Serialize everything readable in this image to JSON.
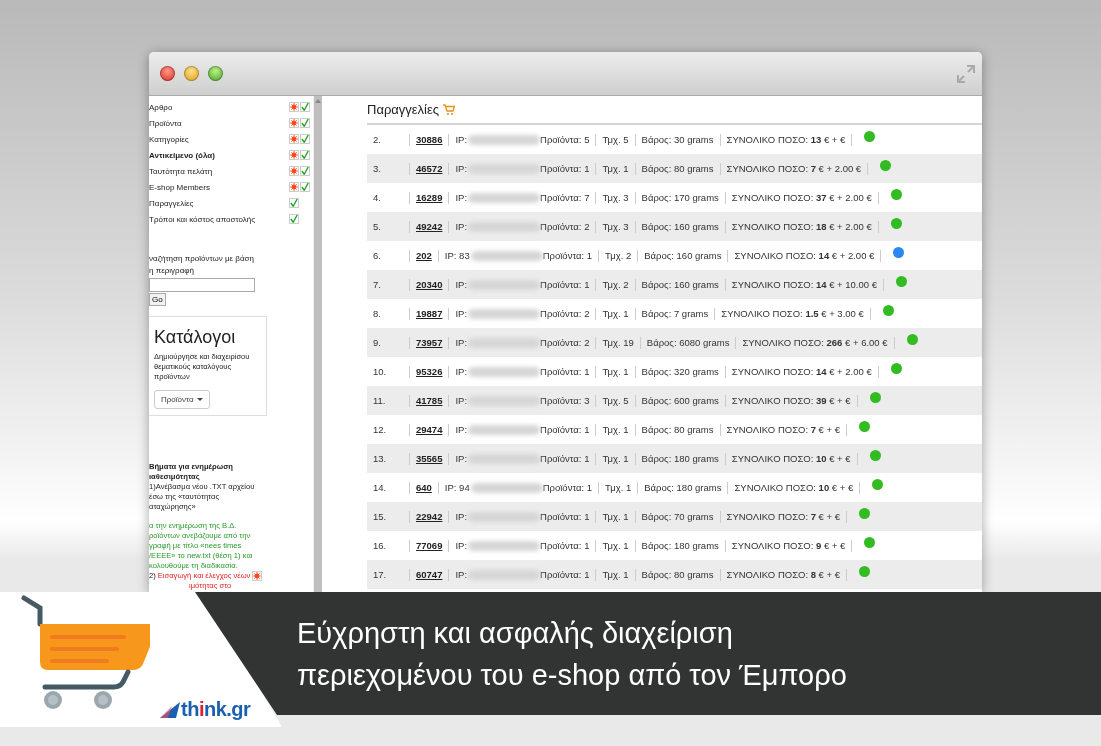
{
  "sidebar": {
    "items": [
      {
        "label": "Αρθρο",
        "kind": "full",
        "emphasized": false
      },
      {
        "label": "Προϊόντα",
        "kind": "full",
        "emphasized": false
      },
      {
        "label": "Κατηγορίες",
        "kind": "full",
        "emphasized": false
      },
      {
        "label": "Αντικείμενο (όλα)",
        "kind": "full",
        "emphasized": true
      },
      {
        "label": "Ταυτότητα πελάτη",
        "kind": "full",
        "emphasized": false
      },
      {
        "label": "E-shop Members",
        "kind": "full",
        "emphasized": false
      },
      {
        "label": "Παραγγελίες",
        "kind": "check",
        "emphasized": false
      },
      {
        "label": "Τρόποι και κόστος αποστολής",
        "kind": "check",
        "emphasized": false
      }
    ],
    "search": {
      "label_lines": [
        "ναζήτηση προϊόντων με βάση",
        "η περιγραφή"
      ],
      "button": "Go"
    },
    "catalog": {
      "title": "Κατάλογοι",
      "description": "Δημιούργησε και διαχειρίσου θεματικούς καταλόγους προϊόντων",
      "button": "Προϊόντα"
    },
    "steps": [
      {
        "kind": "heading",
        "lines": [
          "Βήματα για ενημέρωση",
          "ιαθεσιμότητας"
        ]
      },
      {
        "kind": "plain",
        "lines": [
          "1)Ανέβασμα νέου .TXT αρχείου",
          "έσω της «ταυτότητας",
          "αταχώρησης»"
        ]
      },
      {
        "kind": "note",
        "lines": [
          "α την ενημέρωση της Β.Δ.",
          "ροϊόντων ανεβάζουμε από την",
          "γραφή με τίτλο «nees times",
          "/EEEE» το new.txt (θέση 1) και",
          "κολουθούμε τη διαδικασία."
        ]
      },
      {
        "kind": "step",
        "number": "2)",
        "lines": [
          "Εισαγωγή και έλεγχος νέων",
          "ιμότητας στο"
        ]
      }
    ]
  },
  "orders": {
    "title": "Παραγγελίες",
    "rows": [
      {
        "num": "2.",
        "id": "30886",
        "ip": "IP:",
        "products": "Προϊόντα: 5",
        "pieces": "Τμχ. 5",
        "weight": "Βάρος: 30 grams",
        "total": "ΣΥΝΟΛΙΚΟ ΠΟΣΟ: **13** € + €",
        "color": "#33bb22"
      },
      {
        "num": "3.",
        "id": "46572",
        "ip": "IP:",
        "products": "Προϊόντα: 1",
        "pieces": "Τμχ. 1",
        "weight": "Βάρος: 80 grams",
        "total": "ΣΥΝΟΛΙΚΟ ΠΟΣΟ: **7** € + 2.00 €",
        "color": "#33bb22"
      },
      {
        "num": "4.",
        "id": "16289",
        "ip": "IP:",
        "products": "Προϊόντα: 7",
        "pieces": "Τμχ. 3",
        "weight": "Βάρος: 170 grams",
        "total": "ΣΥΝΟΛΙΚΟ ΠΟΣΟ: **37** € + 2.00 €",
        "color": "#33bb22"
      },
      {
        "num": "5.",
        "id": "49242",
        "ip": "IP:",
        "products": "Προϊόντα: 2",
        "pieces": "Τμχ. 3",
        "weight": "Βάρος: 160 grams",
        "total": "ΣΥΝΟΛΙΚΟ ΠΟΣΟ: **18** € + 2.00 €",
        "color": "#33bb22"
      },
      {
        "num": "6.",
        "id": "202",
        "ip": "IP: 83",
        "products": "Προϊόντα: 1",
        "pieces": "Τμχ. 2",
        "weight": "Βάρος: 160 grams",
        "total": "ΣΥΝΟΛΙΚΟ ΠΟΣΟ: **14** € + 2.00 €",
        "color": "#2a88ee"
      },
      {
        "num": "7.",
        "id": "20340",
        "ip": "IP:",
        "products": "Προϊόντα: 1",
        "pieces": "Τμχ. 2",
        "weight": "Βάρος: 160 grams",
        "total": "ΣΥΝΟΛΙΚΟ ΠΟΣΟ: **14** € + 10.00 €",
        "color": "#33bb22"
      },
      {
        "num": "8.",
        "id": "19887",
        "ip": "IP:",
        "products": "Προϊόντα: 2",
        "pieces": "Τμχ. 1",
        "weight": "Βάρος: 7 grams",
        "total": "ΣΥΝΟΛΙΚΟ ΠΟΣΟ: **1.5** € + 3.00 €",
        "color": "#33bb22"
      },
      {
        "num": "9.",
        "id": "73957",
        "ip": "IP:",
        "products": "Προϊόντα: 2",
        "pieces": "Τμχ. 19",
        "weight": "Βάρος: 6080 grams",
        "total": "ΣΥΝΟΛΙΚΟ ΠΟΣΟ: **266** € + 6.00 €",
        "color": "#33bb22"
      },
      {
        "num": "10.",
        "id": "95326",
        "ip": "IP:",
        "products": "Προϊόντα: 1",
        "pieces": "Τμχ. 1",
        "weight": "Βάρος: 320 grams",
        "total": "ΣΥΝΟΛΙΚΟ ΠΟΣΟ: **14** € + 2.00 €",
        "color": "#33bb22"
      },
      {
        "num": "11.",
        "id": "41785",
        "ip": "IP:",
        "products": "Προϊόντα: 3",
        "pieces": "Τμχ. 5",
        "weight": "Βάρος: 600 grams",
        "total": "ΣΥΝΟΛΙΚΟ ΠΟΣΟ: **39** € + €",
        "color": "#33bb22"
      },
      {
        "num": "12.",
        "id": "29474",
        "ip": "IP:",
        "products": "Προϊόντα: 1",
        "pieces": "Τμχ. 1",
        "weight": "Βάρος: 80 grams",
        "total": "ΣΥΝΟΛΙΚΟ ΠΟΣΟ: **7** € + €",
        "color": "#33bb22"
      },
      {
        "num": "13.",
        "id": "35565",
        "ip": "IP:",
        "products": "Προϊόντα: 1",
        "pieces": "Τμχ. 1",
        "weight": "Βάρος: 180 grams",
        "total": "ΣΥΝΟΛΙΚΟ ΠΟΣΟ: **10** € + €",
        "color": "#33bb22"
      },
      {
        "num": "14.",
        "id": "640",
        "ip": "IP: 94",
        "products": "Προϊόντα: 1",
        "pieces": "Τμχ. 1",
        "weight": "Βάρος: 180 grams",
        "total": "ΣΥΝΟΛΙΚΟ ΠΟΣΟ: **10** € + €",
        "color": "#33bb22"
      },
      {
        "num": "15.",
        "id": "22942",
        "ip": "IP:",
        "products": "Προϊόντα: 1",
        "pieces": "Τμχ. 1",
        "weight": "Βάρος: 70 grams",
        "total": "ΣΥΝΟΛΙΚΟ ΠΟΣΟ: **7** € + €",
        "color": "#33bb22"
      },
      {
        "num": "16.",
        "id": "77069",
        "ip": "IP:",
        "products": "Προϊόντα: 1",
        "pieces": "Τμχ. 1",
        "weight": "Βάρος: 180 grams",
        "total": "ΣΥΝΟΛΙΚΟ ΠΟΣΟ: **9** € + €",
        "color": "#33bb22"
      },
      {
        "num": "17.",
        "id": "60747",
        "ip": "IP:",
        "products": "Προϊόντα: 1",
        "pieces": "Τμχ. 1",
        "weight": "Βάρος: 80 grams",
        "total": "ΣΥΝΟΛΙΚΟ ΠΟΣΟ: **8** € + €",
        "color": "#33bb22"
      }
    ]
  },
  "banner": {
    "headline_lines": [
      "Εύχρηστη και ασφαλής διαχείριση",
      "περιεχομένου του e-shop από τον Έμπορο"
    ],
    "logo": [
      {
        "text": "th",
        "accent": false
      },
      {
        "text": "i",
        "accent": true
      },
      {
        "text": "nk.gr",
        "accent": false
      }
    ]
  }
}
